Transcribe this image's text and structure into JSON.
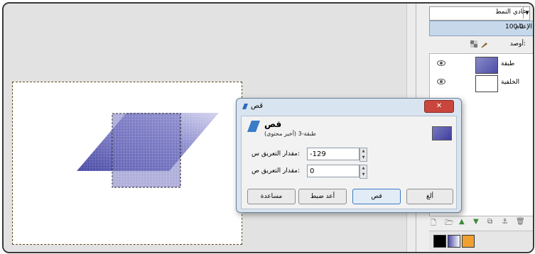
{
  "dock": {
    "mode_label": "عادي النمط",
    "opacity_label": "الإعتام",
    "opacity_value": "100.0",
    "lock_label": "أوصد:",
    "layers": [
      {
        "name": "طبقة"
      },
      {
        "name": "الخلفية"
      }
    ],
    "buttons": [
      "🗋",
      "🗁",
      "▲",
      "▼",
      "⧉",
      "⚓",
      "🗑"
    ]
  },
  "dialog": {
    "title": "قص",
    "close_label": "✕",
    "header_title": "قص",
    "header_subtitle": "طبقة-3 (أخير محتوى)",
    "offset_x_label": "مقدار التعريق س:",
    "offset_x_value": "-129",
    "offset_y_label": "مقدار التعريق ص:",
    "offset_y_value": "0",
    "help_label": "مساعدة",
    "reset_label": "أعد ضبط",
    "shear_label": "قص",
    "cancel_label": "ألغ"
  },
  "colors": {
    "accent": "#3d7bbd",
    "shape": "#5b5bb0",
    "close": "#c9463d"
  }
}
